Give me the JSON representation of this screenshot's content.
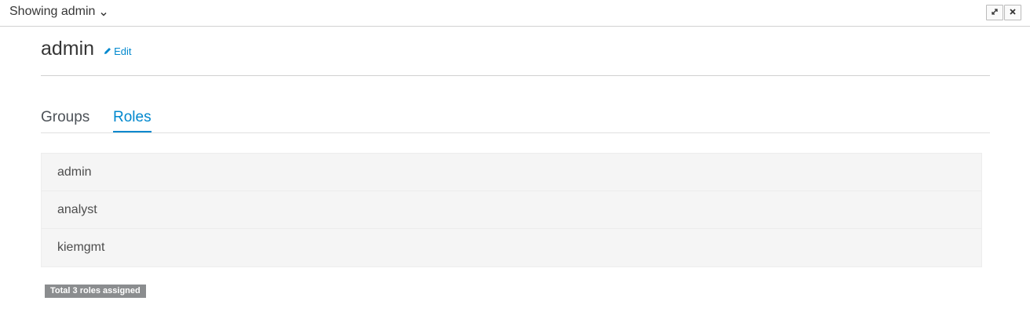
{
  "window": {
    "title": "Showing admin",
    "maximize_icon": "expand-icon",
    "close_icon": "close-icon"
  },
  "header": {
    "username": "admin",
    "edit_label": "Edit"
  },
  "tabs": [
    {
      "label": "Groups",
      "active": false
    },
    {
      "label": "Roles",
      "active": true
    }
  ],
  "roles": [
    "admin",
    "analyst",
    "kiemgmt"
  ],
  "summary": {
    "total_label": "Total 3 roles assigned"
  },
  "colors": {
    "accent": "#0088ce",
    "badge": "#8b8d8f",
    "row_bg": "#f5f5f5"
  }
}
